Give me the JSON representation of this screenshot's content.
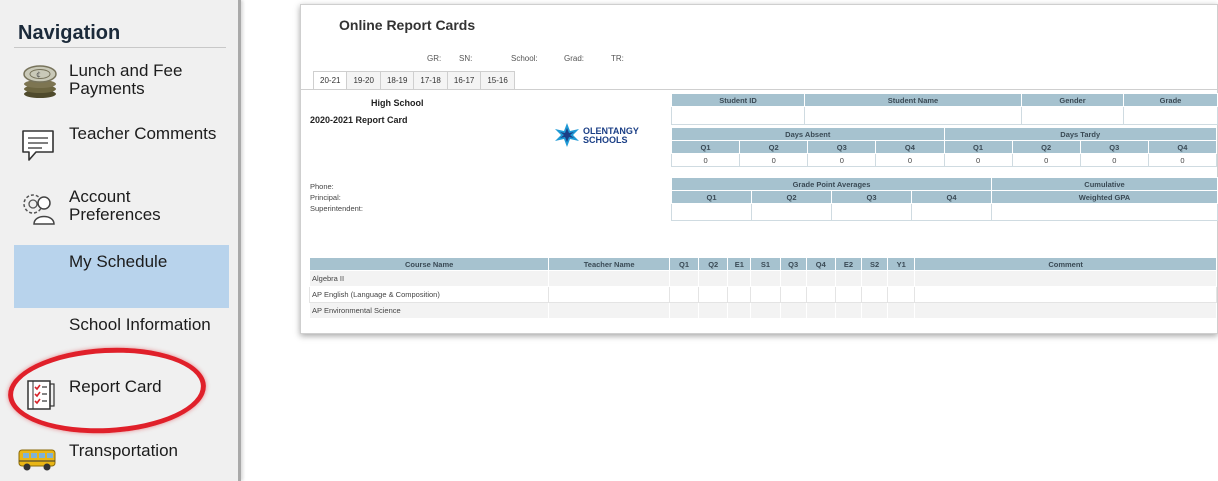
{
  "nav": {
    "title": "Navigation",
    "items": [
      {
        "label": "Lunch and Fee Payments",
        "icon": "coins-icon"
      },
      {
        "label": "Teacher Comments",
        "icon": "comment-icon"
      },
      {
        "label": "Account Preferences",
        "icon": "user-gear-icon"
      },
      {
        "label": "My Schedule",
        "icon": ""
      },
      {
        "label": "School Information",
        "icon": ""
      },
      {
        "label": "Report Card",
        "icon": "checklist-icon"
      },
      {
        "label": "Transportation",
        "icon": "bus-icon"
      }
    ]
  },
  "report": {
    "title": "Online Report Cards",
    "meta": {
      "gr": "GR:",
      "sn": "SN:",
      "school": "School:",
      "grad": "Grad:",
      "tr": "TR:"
    },
    "tabs": [
      "20-21",
      "19-20",
      "18-19",
      "17-18",
      "16-17",
      "15-16"
    ],
    "school_name": "High School",
    "report_year": "2020-2021 Report Card",
    "contact": {
      "phone": "Phone:",
      "principal": "Principal:",
      "superintendent": "Superintendent:"
    },
    "logo": {
      "line1": "OLENTANGY",
      "line2": "SCHOOLS"
    },
    "student_headers": [
      "Student ID",
      "Student Name",
      "Gender",
      "Grade"
    ],
    "attendance": {
      "absent_label": "Days Absent",
      "tardy_label": "Days Tardy",
      "quarters": [
        "Q1",
        "Q2",
        "Q3",
        "Q4"
      ],
      "absent_values": [
        "0",
        "0",
        "0",
        "0"
      ],
      "tardy_values": [
        "0",
        "0",
        "0",
        "0"
      ]
    },
    "gpa": {
      "label": "Grade Point Averages",
      "cumulative_label": "Cumulative",
      "quarters": [
        "Q1",
        "Q2",
        "Q3",
        "Q4"
      ],
      "weighted_label": "Weighted GPA"
    },
    "courses": {
      "headers": [
        "Course Name",
        "Teacher Name",
        "Q1",
        "Q2",
        "E1",
        "S1",
        "Q3",
        "Q4",
        "E2",
        "S2",
        "Y1",
        "Comment"
      ],
      "rows": [
        {
          "name": "Algebra II"
        },
        {
          "name": "AP English (Language & Composition)"
        },
        {
          "name": "AP Environmental Science"
        }
      ]
    }
  },
  "colors": {
    "header_fill": "#a6c2cf",
    "selected_nav": "#b8d3ec",
    "highlight": "#e0202a"
  }
}
